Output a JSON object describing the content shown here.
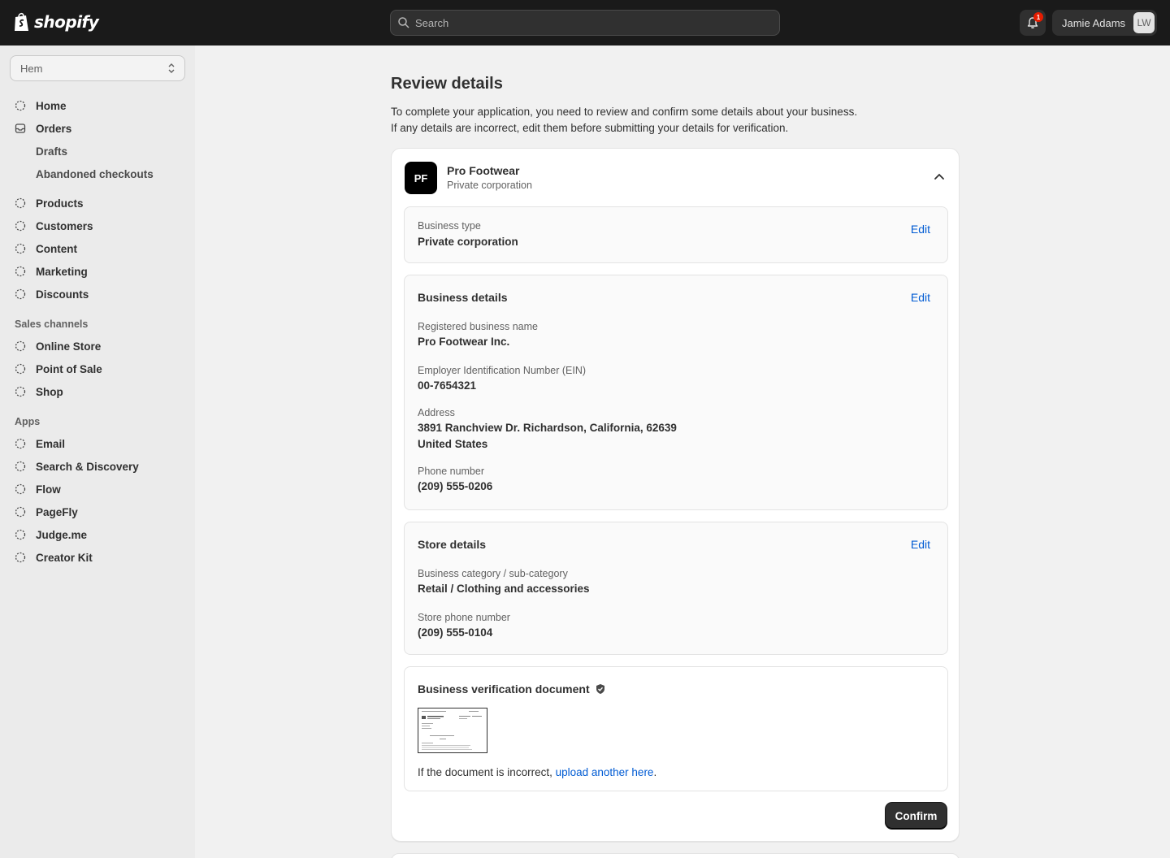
{
  "topbar": {
    "logo_text": "shopify",
    "search_placeholder": "Search",
    "notification_count": "1",
    "user_name": "Jamie Adams",
    "user_initials": "LW"
  },
  "sidebar": {
    "store_name": "Hem",
    "main_items": [
      {
        "label": "Home",
        "icon": "home-icon"
      },
      {
        "label": "Orders",
        "icon": "inbox-icon"
      }
    ],
    "order_subitems": [
      "Drafts",
      "Abandoned checkouts"
    ],
    "more_items": [
      "Products",
      "Customers",
      "Content",
      "Marketing",
      "Discounts"
    ],
    "sales_channels_heading": "Sales channels",
    "sales_channels": [
      "Online Store",
      "Point of Sale",
      "Shop"
    ],
    "apps_heading": "Apps",
    "apps": [
      "Email",
      "Search & Discovery",
      "Flow",
      "PageFly",
      "Judge.me",
      "Creator Kit"
    ]
  },
  "main": {
    "title": "Review details",
    "intro_line1": "To complete your application, you need to review and confirm some details about your business.",
    "intro_line2": "If any details are incorrect, edit them before submitting your details for verification.",
    "company": {
      "initials": "PF",
      "name": "Pro Footwear",
      "type": "Private corporation"
    },
    "business_type": {
      "label": "Business type",
      "value": "Private corporation",
      "edit": "Edit"
    },
    "business_details": {
      "title": "Business details",
      "edit": "Edit",
      "registered_name_label": "Registered business name",
      "registered_name": "Pro Footwear Inc.",
      "ein_label": "Employer Identification Number (EIN)",
      "ein": "00-7654321",
      "address_label": "Address",
      "address_line1": "3891 Ranchview Dr. Richardson, California, 62639",
      "address_line2": "United States",
      "phone_label": "Phone number",
      "phone": "(209) 555-0206"
    },
    "store_details": {
      "title": "Store details",
      "edit": "Edit",
      "category_label": "Business category / sub-category",
      "category": "Retail / Clothing and accessories",
      "phone_label": "Store phone number",
      "phone": "(209) 555-0104"
    },
    "verification": {
      "title": "Business verification document",
      "note_prefix": "If the document is incorrect,",
      "note_link": "upload another here",
      "note_suffix": "."
    },
    "confirm_label": "Confirm"
  },
  "colors": {
    "topbar_bg": "#1a1a1a",
    "link": "#005bd3",
    "badge": "#e51c00",
    "primary_button": "#303030"
  }
}
